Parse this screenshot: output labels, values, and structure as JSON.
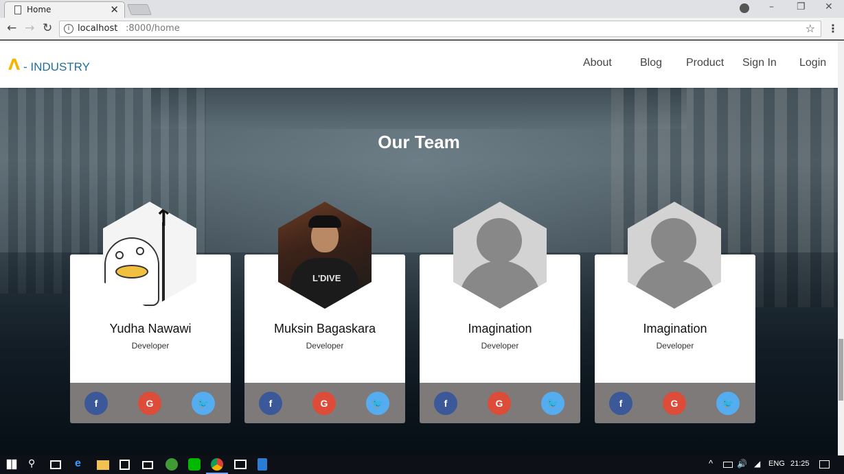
{
  "browser": {
    "tab_title": "Home",
    "tab_close": "✕",
    "url_host": "localhost",
    "url_path": ":8000/home",
    "window_controls": [
      "–",
      "❐",
      "✕"
    ]
  },
  "header": {
    "logo_mark": "Λ",
    "logo_text": "- INDUSTRY",
    "nav": [
      "About",
      "Blog",
      "Product",
      "Sign In",
      "Login"
    ]
  },
  "section": {
    "title": "Our Team"
  },
  "team": [
    {
      "name": "Yudha Nawawi",
      "role": "Developer",
      "avatar": "cartoon-duck"
    },
    {
      "name": "Muksin Bagaskara",
      "role": "Developer",
      "avatar": "photo",
      "photo_text": "L'DIVE"
    },
    {
      "name": "Imagination",
      "role": "Developer",
      "avatar": "placeholder"
    },
    {
      "name": "Imagination",
      "role": "Developer",
      "avatar": "placeholder"
    }
  ],
  "social_labels": {
    "facebook": "f",
    "google": "G",
    "twitter": "🐦"
  },
  "colors": {
    "facebook": "#3b5998",
    "google": "#dd4b39",
    "twitter": "#55acee",
    "footer": "#7f7a7a",
    "logo_accent": "#f5b400",
    "logo_text": "#1f6ea0"
  },
  "taskbar": {
    "language": "ENG",
    "time": "21:25"
  }
}
